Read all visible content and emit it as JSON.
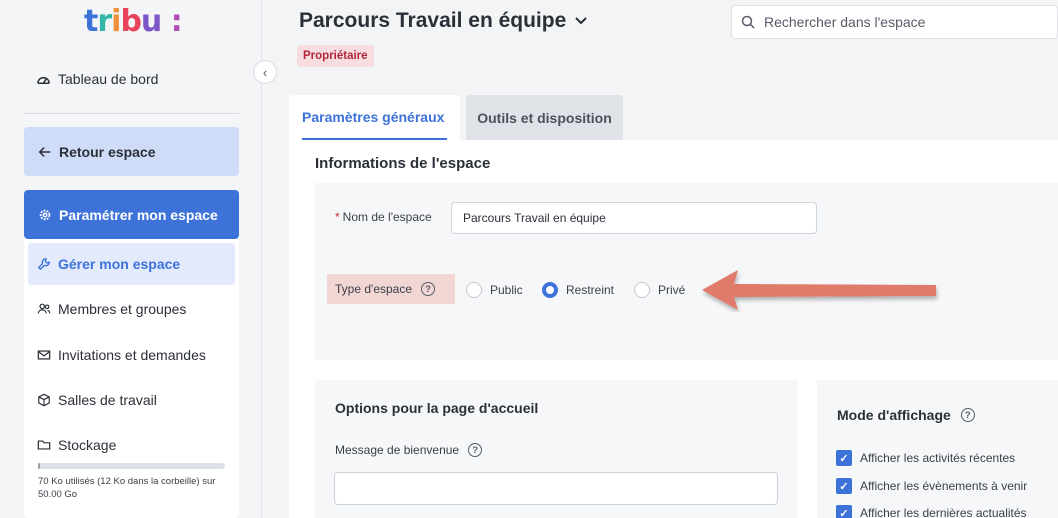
{
  "logo": {
    "text": "tribu",
    "colon": ":"
  },
  "sidebar": {
    "dashboard": "Tableau de bord",
    "back": "Retour espace",
    "settings": "Paramétrer mon espace",
    "items": [
      {
        "label": "Gérer mon espace",
        "icon": "wrench-icon"
      },
      {
        "label": "Membres et groupes",
        "icon": "users-icon"
      },
      {
        "label": "Invitations et demandes",
        "icon": "mail-icon"
      },
      {
        "label": "Salles de travail",
        "icon": "cube-icon"
      },
      {
        "label": "Stockage",
        "icon": "folder-icon"
      }
    ],
    "storage": {
      "used_fraction": 0.0014,
      "text": "70 Ko utilisés (12 Ko dans la corbeille) sur 50.00 Go"
    }
  },
  "header": {
    "title": "Parcours Travail en équipe",
    "badge": "Propriétaire",
    "search_placeholder": "Rechercher dans l'espace"
  },
  "tabs": [
    {
      "label": "Paramètres généraux",
      "active": true
    },
    {
      "label": "Outils et disposition",
      "active": false
    }
  ],
  "info": {
    "title": "Informations de l'espace",
    "name_label": "Nom de l'espace",
    "name_required": "*",
    "name_value": "Parcours Travail en équipe",
    "type_label": "Type d'espace",
    "type_options": [
      "Public",
      "Restreint",
      "Privé"
    ],
    "type_selected": "Restreint"
  },
  "options": {
    "title": "Options pour la page d'accueil",
    "message_label": "Message de bienvenue",
    "message_value": ""
  },
  "display": {
    "title": "Mode d'affichage",
    "checks": [
      "Afficher les activités récentes",
      "Afficher les évènements à venir",
      "Afficher les dernières actualités"
    ]
  },
  "colors": {
    "accent": "#3d73d9",
    "badge_bg": "#f7dde0",
    "highlight": "#f2d6d3",
    "arrow": "#e07a6a"
  }
}
